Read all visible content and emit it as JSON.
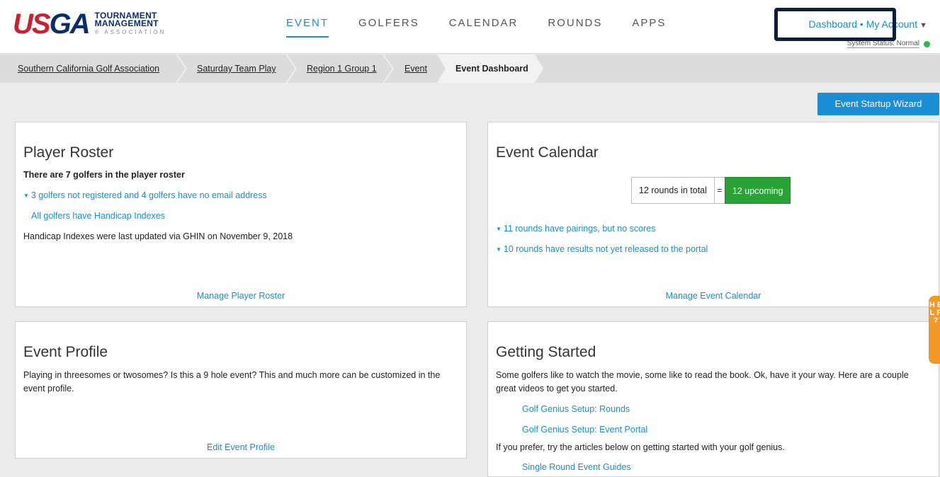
{
  "logo": {
    "usga_u": "US",
    "usga_ga": "GA",
    "line1": "TOURNAMENT",
    "line2": "MANAGEMENT",
    "line3": "® ASSOCIATION"
  },
  "nav": [
    "EVENT",
    "GOLFERS",
    "CALENDAR",
    "ROUNDS",
    "APPS"
  ],
  "account": {
    "dashboard": "Dashboard",
    "sep": " • ",
    "my_account": "My Account",
    "caret": "▼",
    "status": "System Status: Normal"
  },
  "breadcrumb": [
    "Southern California Golf Association",
    "Saturday Team Play",
    "Region 1 Group 1",
    "Event"
  ],
  "breadcrumb_current": "Event Dashboard",
  "wizard_button": "Event Startup Wizard",
  "player_roster": {
    "title": "Player Roster",
    "summary": "There are 7 golfers in the player roster",
    "registration": "3 golfers not registered and 4 golfers have no email address",
    "handicap": "All golfers have Handicap Indexes",
    "updated": "Handicap Indexes were last updated via GHIN on November 9, 2018",
    "manage": "Manage Player Roster"
  },
  "event_calendar": {
    "title": "Event Calendar",
    "total": "12 rounds in total",
    "equals": "=",
    "upcoming": "12 upcoming",
    "pairings": "11 rounds have pairings, but no scores",
    "results": "10 rounds have results not yet released to the portal",
    "manage": "Manage Event Calendar"
  },
  "event_profile": {
    "title": "Event Profile",
    "text": "Playing in threesomes or twosomes? Is this a 9 hole event? This and much more can be customized in the event profile.",
    "edit": "Edit Event Profile"
  },
  "getting_started": {
    "title": "Getting Started",
    "intro": "Some golfers like to watch the movie, some like to read the book. Ok, have it your way. Here are a couple great videos to get you started.",
    "video1": "Golf Genius Setup: Rounds",
    "video2": "Golf Genius Setup: Event Portal",
    "articles": "If you prefer, try the articles below on getting started with your golf genius.",
    "guides": "Single Round Event Guides"
  },
  "help_tab": "H E L P ?",
  "colors": {
    "accent": "#1a8fc8",
    "upcoming": "#29a335",
    "help": "#f29a25",
    "logo_red": "#cc1f2f",
    "logo_navy": "#0b2d6b"
  }
}
